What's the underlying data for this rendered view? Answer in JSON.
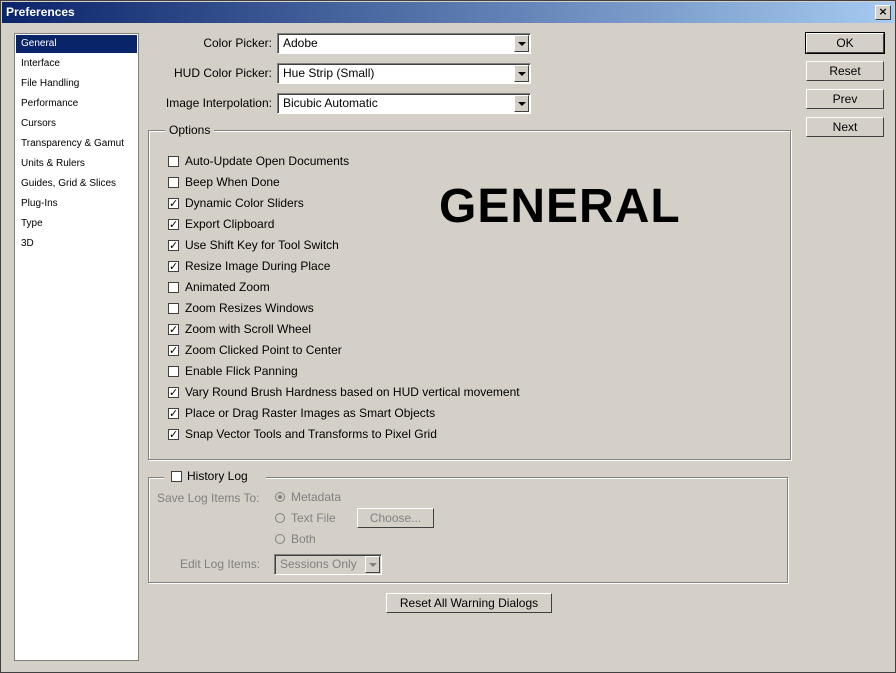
{
  "window": {
    "title": "Preferences",
    "close_glyph": "×"
  },
  "sidebar": {
    "items": [
      {
        "label": "General"
      },
      {
        "label": "Interface"
      },
      {
        "label": "File Handling"
      },
      {
        "label": "Performance"
      },
      {
        "label": "Cursors"
      },
      {
        "label": "Transparency & Gamut"
      },
      {
        "label": "Units & Rulers"
      },
      {
        "label": "Guides, Grid & Slices"
      },
      {
        "label": "Plug-Ins"
      },
      {
        "label": "Type"
      },
      {
        "label": "3D"
      }
    ]
  },
  "fields": {
    "color_picker_label": "Color Picker:",
    "color_picker_value": "Adobe",
    "hud_label": "HUD Color Picker:",
    "hud_value": "Hue Strip (Small)",
    "interp_label": "Image Interpolation:",
    "interp_value": "Bicubic Automatic"
  },
  "options": {
    "legend": "Options",
    "items": [
      {
        "label": "Auto-Update Open Documents",
        "checked": false
      },
      {
        "label": "Beep When Done",
        "checked": false
      },
      {
        "label": "Dynamic Color Sliders",
        "checked": true
      },
      {
        "label": "Export Clipboard",
        "checked": true
      },
      {
        "label": "Use Shift Key for Tool Switch",
        "checked": true
      },
      {
        "label": "Resize Image During Place",
        "checked": true
      },
      {
        "label": "Animated Zoom",
        "checked": false
      },
      {
        "label": "Zoom Resizes Windows",
        "checked": false
      },
      {
        "label": "Zoom with Scroll Wheel",
        "checked": true
      },
      {
        "label": "Zoom Clicked Point to Center",
        "checked": true
      },
      {
        "label": "Enable Flick Panning",
        "checked": false
      },
      {
        "label": "Vary Round Brush Hardness based on HUD vertical movement",
        "checked": true
      },
      {
        "label": "Place or Drag Raster Images as Smart Objects",
        "checked": true
      },
      {
        "label": "Snap Vector Tools and Transforms to Pixel Grid",
        "checked": true
      }
    ]
  },
  "heading": "GENERAL",
  "history": {
    "legend": "History Log",
    "checked": false,
    "save_label": "Save Log Items To:",
    "radio_metadata": "Metadata",
    "radio_textfile": "Text File",
    "radio_both": "Both",
    "choose_label": "Choose...",
    "edit_label": "Edit Log Items:",
    "edit_value": "Sessions Only"
  },
  "buttons": {
    "ok": "OK",
    "reset": "Reset",
    "prev": "Prev",
    "next": "Next",
    "reset_warnings": "Reset All Warning Dialogs"
  },
  "colors": {
    "selection": "#0a246a",
    "dialog_bg": "#d4d0c8"
  }
}
